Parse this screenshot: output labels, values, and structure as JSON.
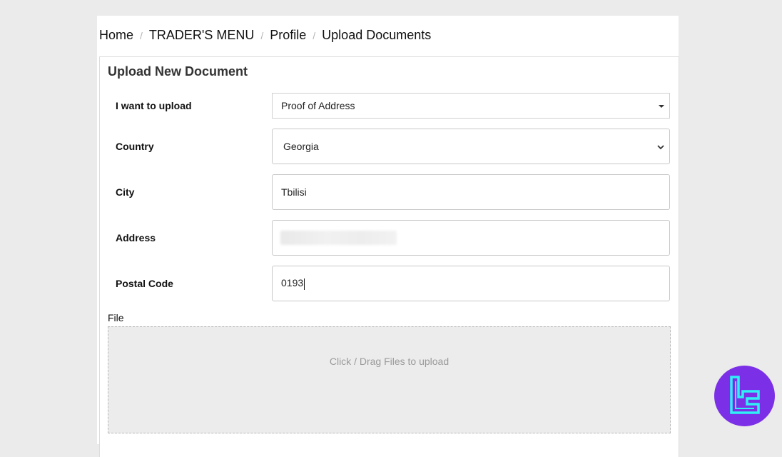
{
  "breadcrumb": {
    "items": [
      "Home",
      "TRADER'S MENU",
      "Profile",
      "Upload Documents"
    ],
    "separator": "/"
  },
  "panel": {
    "title": "Upload New Document"
  },
  "form": {
    "upload_type": {
      "label": "I want to upload",
      "value": "Proof of Address"
    },
    "country": {
      "label": "Country",
      "value": "Georgia"
    },
    "city": {
      "label": "City",
      "value": "Tbilisi"
    },
    "address": {
      "label": "Address",
      "value": ""
    },
    "postal_code": {
      "label": "Postal Code",
      "value": "0193"
    }
  },
  "file": {
    "label": "File",
    "dropzone_text": "Click / Drag Files to upload"
  },
  "logo": {
    "icon": "tc-logo-icon",
    "bg_color": "#7b2fe6",
    "stroke_color": "#2ff0f5"
  },
  "colors": {
    "background": "#ebebeb",
    "panel_border": "#dcdcdc",
    "dropzone_bg": "#ececec"
  }
}
